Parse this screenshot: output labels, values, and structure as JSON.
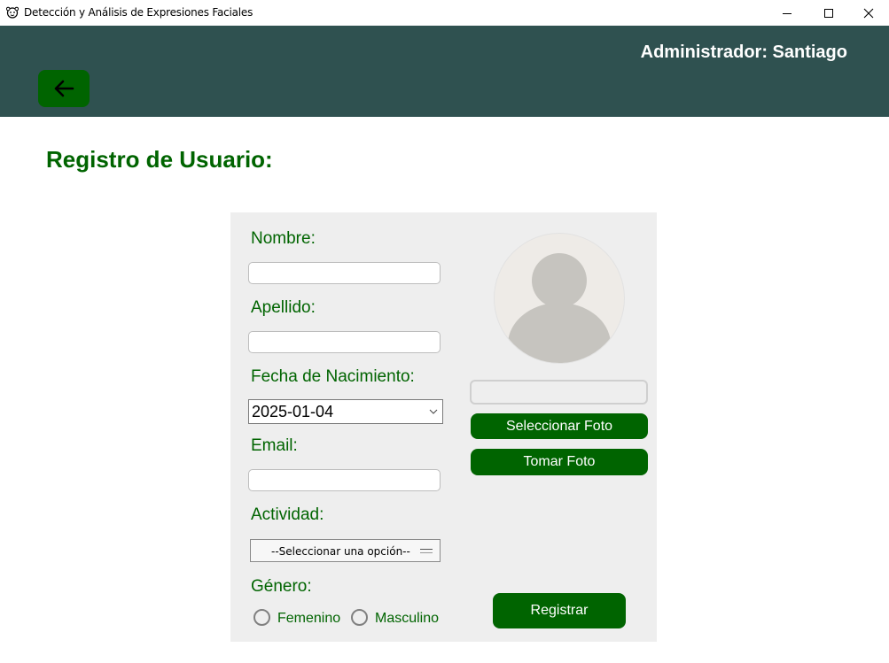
{
  "window": {
    "title": "Detección y Análisis de Expresiones Faciales",
    "icons": {
      "app": "monkey-face-icon",
      "minimize": "minimize-icon",
      "maximize": "maximize-icon",
      "close": "close-icon"
    }
  },
  "header": {
    "admin_label": "Administrador: Santiago",
    "back_icon": "arrow-left-icon",
    "background_color": "#2f5150",
    "accent_color": "#006400"
  },
  "page": {
    "title": "Registro de Usuario:"
  },
  "form": {
    "nombre": {
      "label": "Nombre:",
      "value": ""
    },
    "apellido": {
      "label": "Apellido:",
      "value": ""
    },
    "fecha": {
      "label": "Fecha de Nacimiento:",
      "value": "2025-01-04"
    },
    "email": {
      "label": "Email:",
      "value": ""
    },
    "actividad": {
      "label": "Actividad:",
      "selected": "--Seleccionar una opción--"
    },
    "genero": {
      "label": "Género:",
      "options": [
        "Femenino",
        "Masculino"
      ],
      "selected": null
    }
  },
  "photo": {
    "placeholder_icon": "user-avatar-icon",
    "path_value": "",
    "select_label": "Seleccionar Foto",
    "take_label": "Tomar Foto"
  },
  "actions": {
    "register_label": "Registrar"
  }
}
